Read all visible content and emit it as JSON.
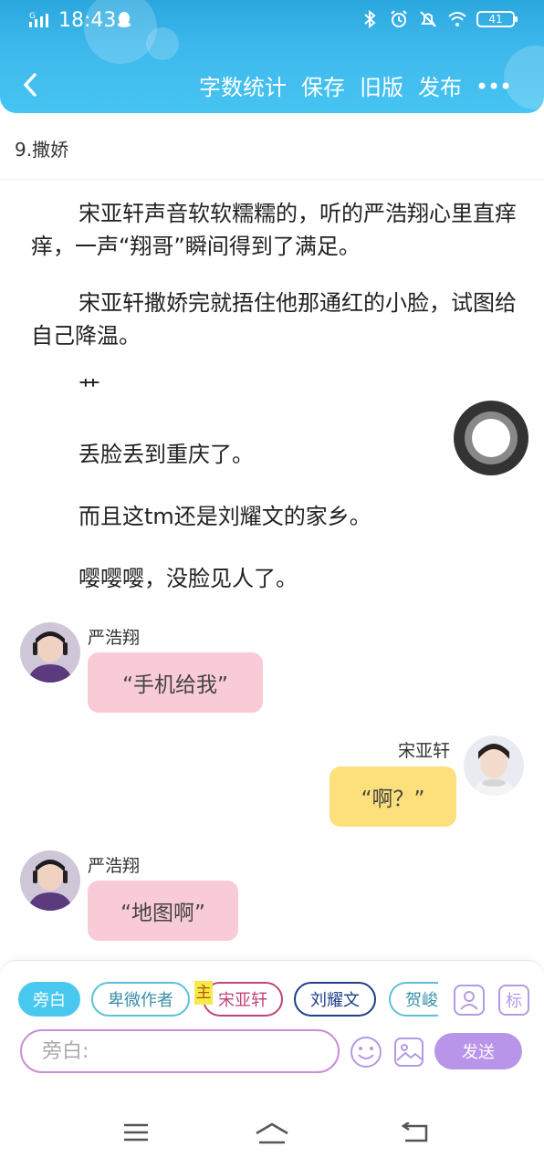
{
  "status_bar": {
    "network_label": "G",
    "time": "18:43",
    "battery": "41"
  },
  "nav": {
    "actions": [
      "字数统计",
      "保存",
      "旧版",
      "发布"
    ]
  },
  "chapter": {
    "title": "9.撒娇"
  },
  "paragraphs": [
    "宋亚轩声音软软糯糯的，听的严浩翔心里直痒痒，一声“翔哥”瞬间得到了满足。",
    "宋亚轩撒娇完就捂住他那通红的小脸，试图给自己降温。",
    "艹",
    "丢脸丢到重庆了。",
    "而且这tm还是刘耀文的家乡。",
    "嘤嘤嘤，没脸见人了。"
  ],
  "messages": [
    {
      "speaker": "严浩翔",
      "text": "“手机给我”",
      "side": "left",
      "color": "#f9cbd7"
    },
    {
      "speaker": "宋亚轩",
      "text": "“啊？”",
      "side": "right",
      "color": "#fde07b"
    },
    {
      "speaker": "严浩翔",
      "text": "“地图啊”",
      "side": "left",
      "color": "#f9cbd7"
    }
  ],
  "composer": {
    "roles": [
      "旁白",
      "卑微作者",
      "宋亚轩",
      "刘耀文",
      "贺峻"
    ],
    "main_tag": "主",
    "mark_label": "标",
    "input_placeholder": "旁白:",
    "send_label": "发送"
  },
  "colors": {
    "header": "#3db8ec",
    "pink_bubble": "#f9cbd7",
    "yellow_bubble": "#fde07b",
    "send": "#b895e8"
  }
}
